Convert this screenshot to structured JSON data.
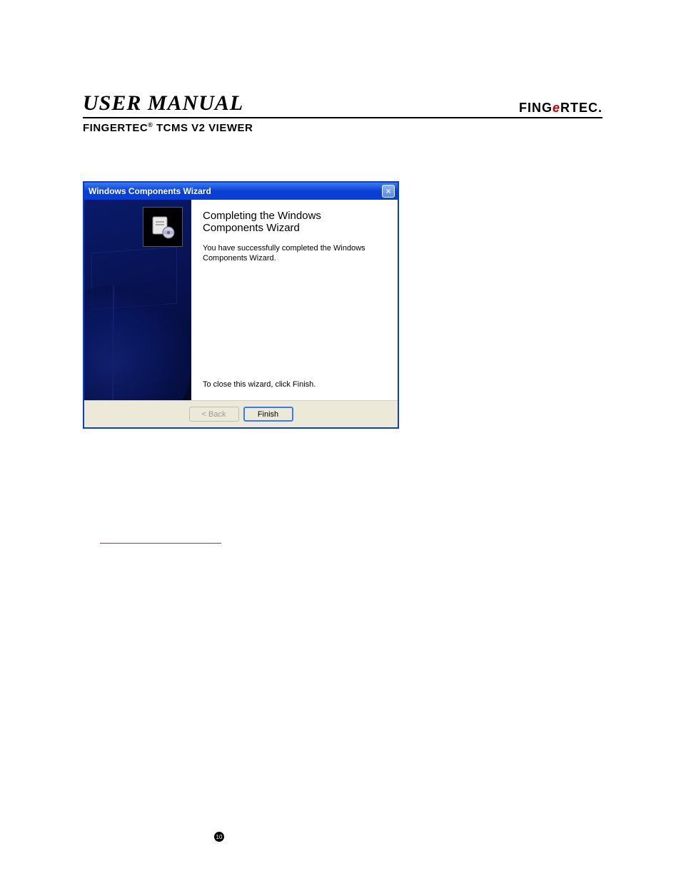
{
  "header": {
    "title": "USER MANUAL",
    "brand_pre": "FING",
    "brand_e": "e",
    "brand_post": "RTEC.",
    "subhead_prefix": "FINGERTEC",
    "subhead_reg": "®",
    "subhead_rest": " TCMS V2 VIEWER"
  },
  "dialog": {
    "title": "Windows Components Wizard",
    "close_glyph": "×",
    "heading": "Completing the Windows Components Wizard",
    "body_text": "You have successfully completed the Windows Components Wizard.",
    "close_hint": "To close this wizard, click Finish.",
    "back_label": "< Back",
    "finish_label": "Finish"
  },
  "page_number": "10"
}
